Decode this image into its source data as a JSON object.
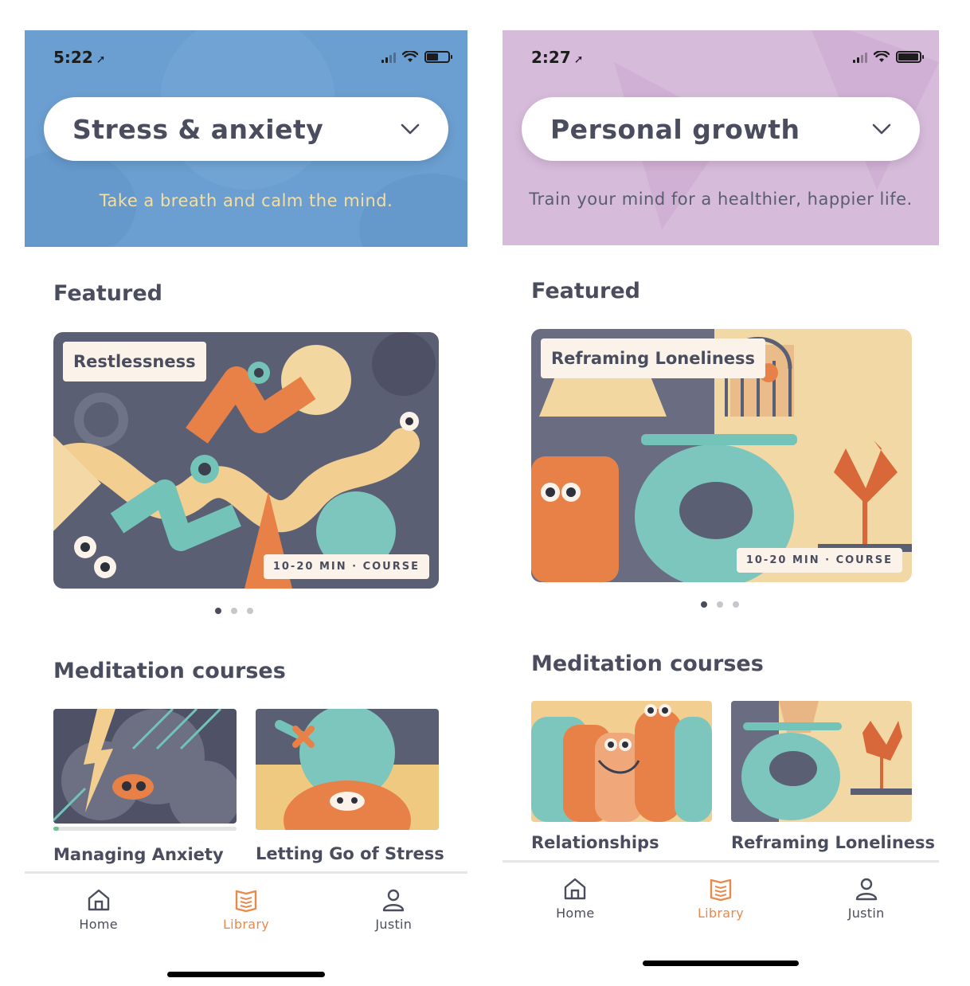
{
  "screens": [
    {
      "status": {
        "time": "5:22",
        "battery_level": 0.5
      },
      "category": {
        "label": "Stress & anxiety",
        "tagline": "Take a breath and calm the mind."
      },
      "colors": {
        "hero": "#6b9fd1",
        "tagline": "#f5dfa0"
      },
      "featured": {
        "heading": "Featured",
        "card": {
          "title": "Restlessness",
          "meta": "10-20 MIN · COURSE"
        },
        "page_indicator": {
          "count": 3,
          "active": 1
        }
      },
      "courses": {
        "heading": "Meditation courses",
        "items": [
          {
            "title": "Managing Anxiety",
            "progress": 0.03
          },
          {
            "title": "Letting Go of Stress"
          }
        ]
      },
      "tabs": [
        {
          "label": "Home",
          "icon": "home-icon"
        },
        {
          "label": "Library",
          "icon": "library-icon",
          "active": true
        },
        {
          "label": "Justin",
          "icon": "profile-icon"
        }
      ]
    },
    {
      "status": {
        "time": "2:27",
        "battery_level": 0.9
      },
      "category": {
        "label": "Personal growth",
        "tagline": "Train your mind for a healthier, happier life."
      },
      "colors": {
        "hero": "#d7bbdb",
        "tagline": "#5a5d6e"
      },
      "featured": {
        "heading": "Featured",
        "card": {
          "title": "Reframing Loneliness",
          "meta": "10-20 MIN · COURSE"
        },
        "page_indicator": {
          "count": 3,
          "active": 1
        }
      },
      "courses": {
        "heading": "Meditation courses",
        "items": [
          {
            "title": "Relationships"
          },
          {
            "title": "Reframing Loneliness"
          }
        ]
      },
      "tabs": [
        {
          "label": "Home",
          "icon": "home-icon"
        },
        {
          "label": "Library",
          "icon": "library-icon",
          "active": true
        },
        {
          "label": "Justin",
          "icon": "profile-icon"
        }
      ]
    }
  ],
  "accent_color": "#e8894e"
}
